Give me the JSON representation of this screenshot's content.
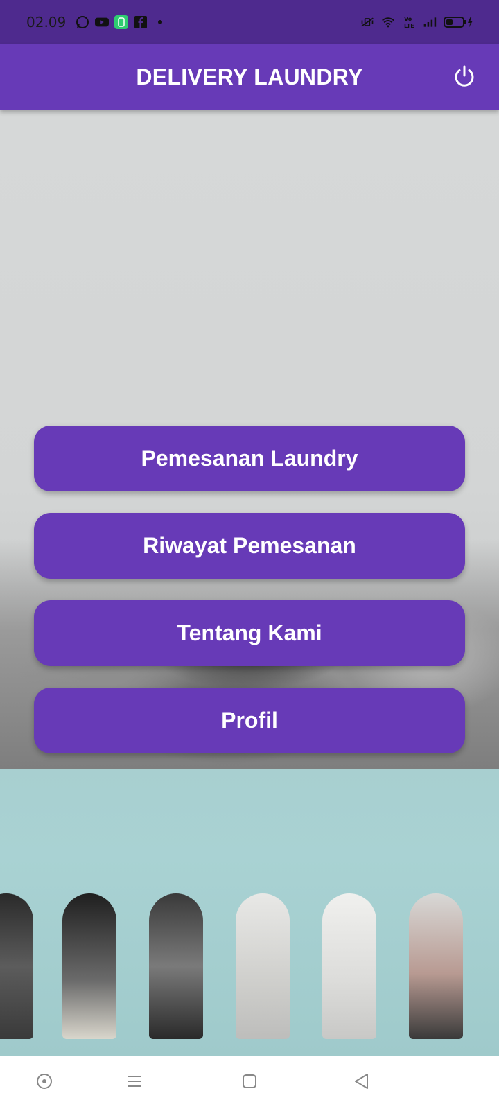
{
  "status_bar": {
    "time": "02.09",
    "left_icons": [
      "whatsapp-icon",
      "youtube-icon",
      "app-badge-icon",
      "facebook-icon",
      "dot-icon"
    ],
    "right_icons": [
      "vibrate-mute-icon",
      "wifi-icon",
      "volte-icon",
      "signal-icon",
      "battery-charging-icon"
    ],
    "badge_color": "#2ecc71"
  },
  "app_bar": {
    "title": "DELIVERY LAUNDRY",
    "power_icon": "power-icon",
    "color": "#673ab7"
  },
  "menu": {
    "items": [
      {
        "label": "Pemesanan Laundry"
      },
      {
        "label": "Riwayat Pemesanan"
      },
      {
        "label": "Tentang Kami"
      },
      {
        "label": "Profil"
      }
    ],
    "button_color": "#673ab7"
  },
  "nav_bar": {
    "items": [
      "assistant-icon",
      "menu-icon",
      "home-icon",
      "back-icon"
    ]
  }
}
